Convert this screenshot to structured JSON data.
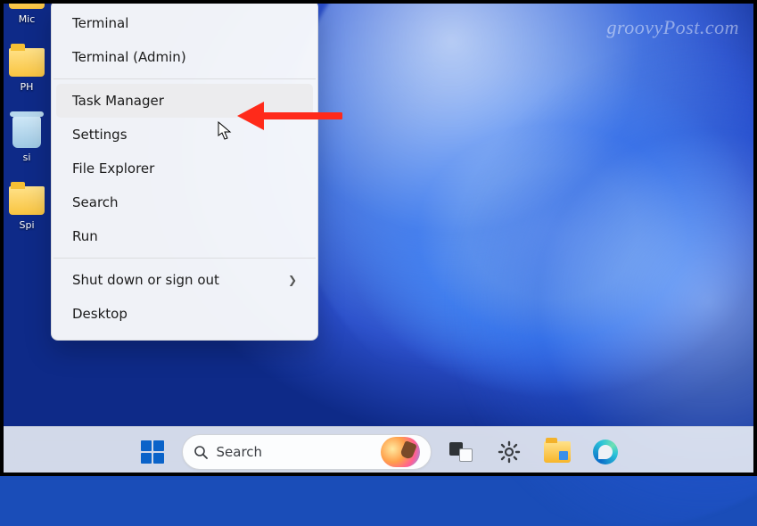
{
  "watermark": "groovyPost.com",
  "desktop": {
    "icons": [
      {
        "label": "Mic"
      },
      {
        "label": "PH"
      },
      {
        "label": "si"
      },
      {
        "label": "Spi"
      }
    ]
  },
  "menu": {
    "items": [
      {
        "label": "Terminal",
        "hover": false,
        "submenu": false
      },
      {
        "label": "Terminal (Admin)",
        "hover": false,
        "submenu": false
      }
    ],
    "items2": [
      {
        "label": "Task Manager",
        "hover": true,
        "submenu": false
      },
      {
        "label": "Settings",
        "hover": false,
        "submenu": false
      },
      {
        "label": "File Explorer",
        "hover": false,
        "submenu": false
      },
      {
        "label": "Search",
        "hover": false,
        "submenu": false
      },
      {
        "label": "Run",
        "hover": false,
        "submenu": false
      }
    ],
    "items3": [
      {
        "label": "Shut down or sign out",
        "hover": false,
        "submenu": true
      },
      {
        "label": "Desktop",
        "hover": false,
        "submenu": false
      }
    ]
  },
  "taskbar": {
    "search_placeholder": "Search"
  }
}
